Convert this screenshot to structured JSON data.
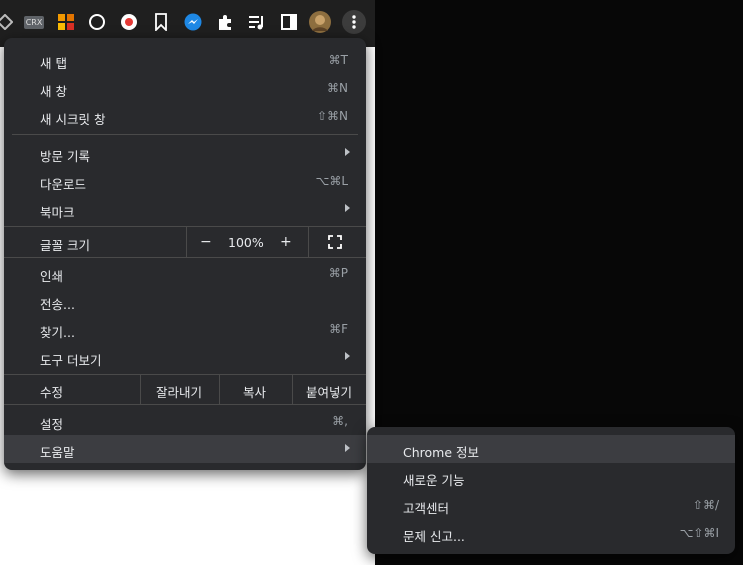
{
  "toolbar": {
    "crx_label": "CRX",
    "icons": [
      "diamond-icon",
      "crx-icon",
      "squares-extension-icon",
      "circle-icon",
      "record-icon",
      "bookmark-icon",
      "messenger-icon",
      "puzzle-icon",
      "playlist-icon",
      "sidebar-icon",
      "avatar",
      "more-icon"
    ]
  },
  "menu": {
    "new_tab": {
      "label": "새 탭",
      "shortcut": "⌘T"
    },
    "new_window": {
      "label": "새 창",
      "shortcut": "⌘N"
    },
    "incognito": {
      "label": "새 시크릿 창",
      "shortcut": "⇧⌘N"
    },
    "history": {
      "label": "방문 기록"
    },
    "downloads": {
      "label": "다운로드",
      "shortcut": "⌥⌘L"
    },
    "bookmarks": {
      "label": "북마크"
    },
    "zoom": {
      "label": "글꼴 크기",
      "minus": "−",
      "value": "100%",
      "plus": "+"
    },
    "print": {
      "label": "인쇄",
      "shortcut": "⌘P"
    },
    "cast": {
      "label": "전송..."
    },
    "find": {
      "label": "찾기...",
      "shortcut": "⌘F"
    },
    "more_tools": {
      "label": "도구 더보기"
    },
    "edit": {
      "label": "수정",
      "cut": "잘라내기",
      "copy": "복사",
      "paste": "붙여넣기"
    },
    "settings": {
      "label": "설정",
      "shortcut": "⌘,"
    },
    "help": {
      "label": "도움말"
    }
  },
  "submenu": {
    "about": {
      "label": "Chrome 정보"
    },
    "whats_new": {
      "label": "새로운 기능"
    },
    "help_center": {
      "label": "고객센터",
      "shortcut": "⇧⌘/"
    },
    "report": {
      "label": "문제 신고...",
      "shortcut": "⌥⇧⌘I"
    }
  },
  "colors": {
    "menu_bg": "#292a2d",
    "highlight": "#3c3d41",
    "toolbar": "#1f1f1f"
  }
}
